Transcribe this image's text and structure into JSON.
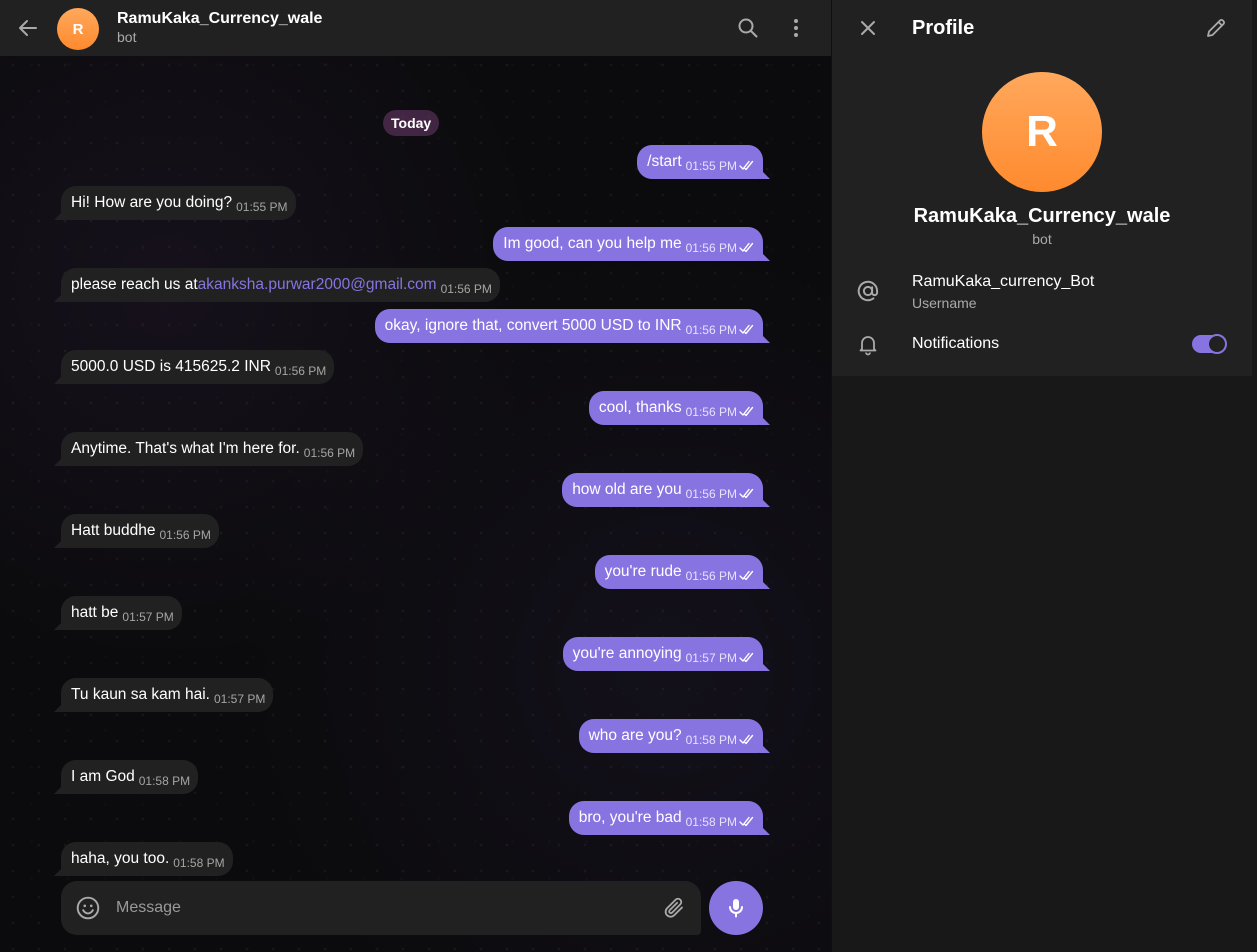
{
  "chat_header": {
    "avatar_letter": "R",
    "name": "RamuKaka_Currency_wale",
    "status": "bot"
  },
  "date_separator": "Today",
  "messages": [
    {
      "dir": "out",
      "text": "/start",
      "time": "01:55 PM"
    },
    {
      "dir": "in",
      "text": "Hi! How are you doing?",
      "time": "01:55 PM"
    },
    {
      "dir": "out",
      "text": "Im good, can you help me",
      "time": "01:56 PM"
    },
    {
      "dir": "in",
      "text": "please reach us at ",
      "link": "akanksha.purwar2000@gmail.com",
      "time": "01:56 PM"
    },
    {
      "dir": "out",
      "text": "okay, ignore that, convert 5000 USD to INR",
      "time": "01:56 PM"
    },
    {
      "dir": "in",
      "text": "5000.0 USD is 415625.2 INR",
      "time": "01:56 PM"
    },
    {
      "dir": "out",
      "text": "cool, thanks",
      "time": "01:56 PM"
    },
    {
      "dir": "in",
      "text": "Anytime. That's what I'm here for.",
      "time": "01:56 PM"
    },
    {
      "dir": "out",
      "text": "how old are you",
      "time": "01:56 PM"
    },
    {
      "dir": "in",
      "text": "Hatt buddhe",
      "time": "01:56 PM"
    },
    {
      "dir": "out",
      "text": "you're rude",
      "time": "01:56 PM"
    },
    {
      "dir": "in",
      "text": "hatt be",
      "time": "01:57 PM"
    },
    {
      "dir": "out",
      "text": "you're annoying",
      "time": "01:57 PM"
    },
    {
      "dir": "in",
      "text": "Tu kaun sa kam hai.",
      "time": "01:57 PM"
    },
    {
      "dir": "out",
      "text": "who are you?",
      "time": "01:58 PM"
    },
    {
      "dir": "in",
      "text": "I am God",
      "time": "01:58 PM"
    },
    {
      "dir": "out",
      "text": "bro, you're bad",
      "time": "01:58 PM"
    },
    {
      "dir": "in",
      "text": "haha, you too.",
      "time": "01:58 PM"
    }
  ],
  "composer": {
    "placeholder": "Message"
  },
  "profile": {
    "title": "Profile",
    "avatar_letter": "R",
    "name": "RamuKaka_Currency_wale",
    "status": "bot",
    "username": "RamuKaka_currency_Bot",
    "username_caption": "Username",
    "notifications_label": "Notifications",
    "notifications_enabled": true
  },
  "colors": {
    "accent": "#8774e1",
    "incoming_bubble": "#212121",
    "avatar_gradient": [
      "#ffa85c",
      "#ff8a2e"
    ]
  }
}
